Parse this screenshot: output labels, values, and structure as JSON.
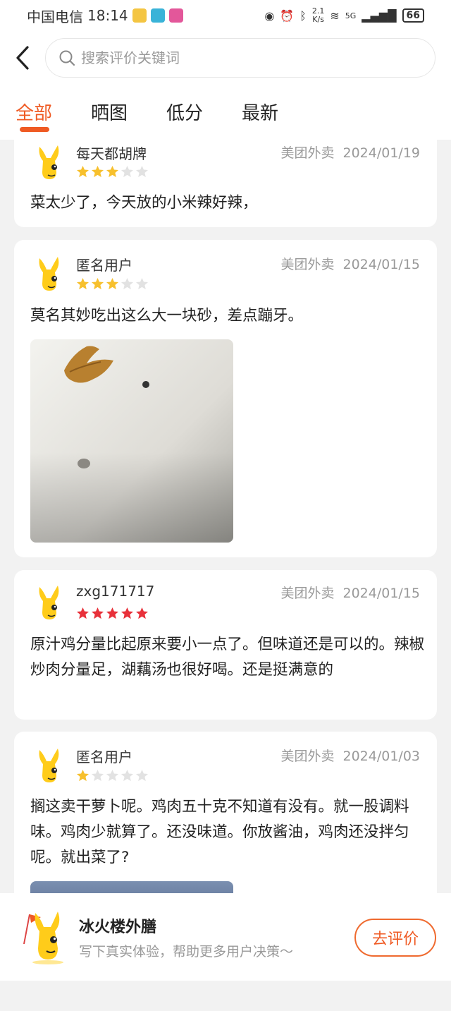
{
  "status_bar": {
    "carrier": "中国电信",
    "time": "18:14",
    "net_speed_top": "2.1",
    "net_speed_bottom": "K/s",
    "signal": "5G",
    "battery": "66"
  },
  "header": {
    "search_placeholder": "搜索评价关键词"
  },
  "tabs": [
    {
      "label": "全部",
      "active": true
    },
    {
      "label": "晒图",
      "active": false
    },
    {
      "label": "低分",
      "active": false
    },
    {
      "label": "最新",
      "active": false
    }
  ],
  "reviews": [
    {
      "user": "每天都胡牌",
      "source": "美团外卖",
      "date": "2024/01/19",
      "rating": 3,
      "text": "菜太少了，今天放的小米辣好辣，"
    },
    {
      "user": "匿名用户",
      "source": "美团外卖",
      "date": "2024/01/15",
      "rating": 3,
      "text": "莫名其妙吃出这么大一块砂，差点蹦牙。"
    },
    {
      "user": "zxg171717",
      "source": "美团外卖",
      "date": "2024/01/15",
      "rating": 5,
      "text": "原汁鸡分量比起原来要小一点了。但味道还是可以的。辣椒炒肉分量足，湖藕汤也很好喝。还是挺满意的"
    },
    {
      "user": "匿名用户",
      "source": "美团外卖",
      "date": "2024/01/03",
      "rating": 1,
      "text": "搁这卖干萝卜呢。鸡肉五十克不知道有没有。就一股调料味。鸡肉少就算了。还没味道。你放酱油，鸡肉还没拌匀呢。就出菜了?"
    }
  ],
  "footer": {
    "shop_name": "冰火楼外膳",
    "subtitle": "写下真实体验，帮助更多用户决策～",
    "button_label": "去评价"
  },
  "colors": {
    "accent": "#ef5a23",
    "star_gold": "#f7c02d",
    "star_red": "#e8313a",
    "star_empty": "#e2e2e2",
    "mascot_yellow": "#ffcc1a"
  }
}
